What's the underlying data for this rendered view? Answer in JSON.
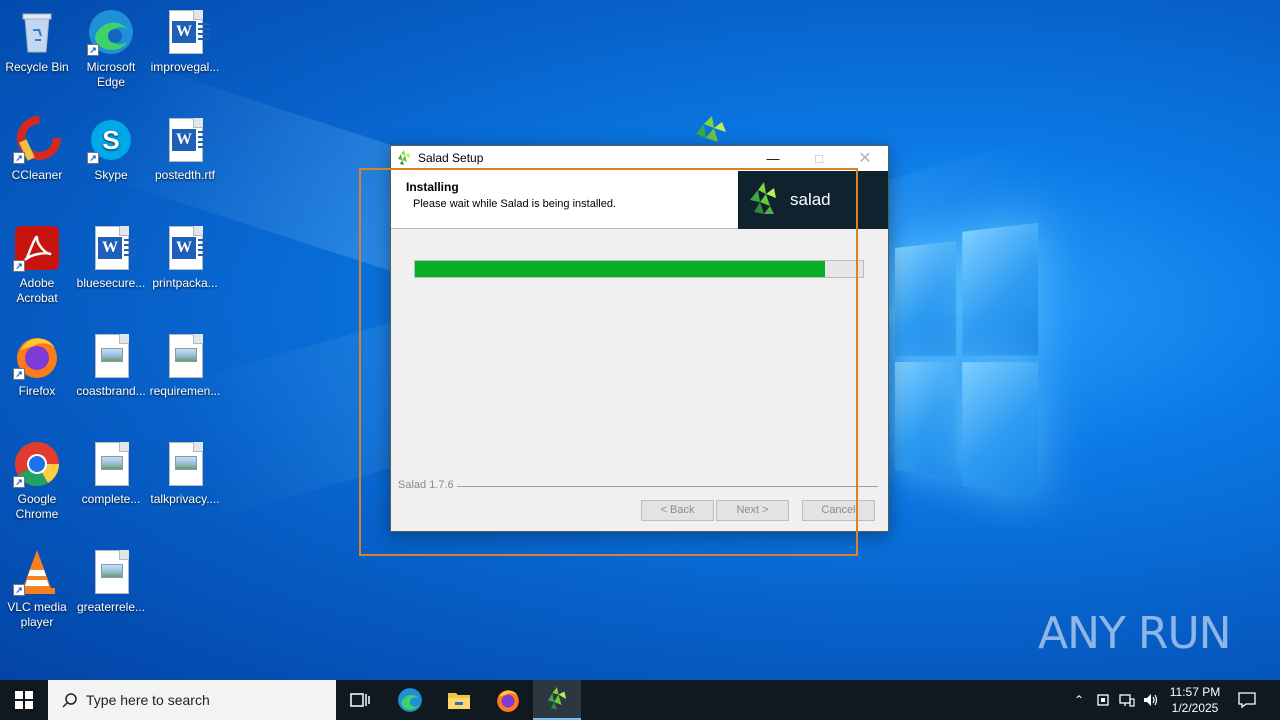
{
  "desktop": {
    "icons": [
      {
        "label": "Recycle Bin",
        "icon": "recycle-bin-icon"
      },
      {
        "label": "Microsoft Edge",
        "icon": "edge-icon"
      },
      {
        "label": "improvegal...",
        "icon": "word-document-icon"
      },
      {
        "label": "CCleaner",
        "icon": "ccleaner-icon"
      },
      {
        "label": "Skype",
        "icon": "skype-icon"
      },
      {
        "label": "postedth.rtf",
        "icon": "word-document-icon"
      },
      {
        "label": "Adobe Acrobat",
        "icon": "adobe-acrobat-icon"
      },
      {
        "label": "bluesecure...",
        "icon": "word-document-icon"
      },
      {
        "label": "printpacka...",
        "icon": "word-document-icon"
      },
      {
        "label": "Firefox",
        "icon": "firefox-icon"
      },
      {
        "label": "coastbrand...",
        "icon": "image-file-icon"
      },
      {
        "label": "requiremen...",
        "icon": "image-file-icon"
      },
      {
        "label": "Google Chrome",
        "icon": "chrome-icon"
      },
      {
        "label": "complete...",
        "icon": "image-file-icon"
      },
      {
        "label": "talkprivacy....",
        "icon": "image-file-icon"
      },
      {
        "label": "VLC media player",
        "icon": "vlc-icon"
      },
      {
        "label": "greaterrele...",
        "icon": "image-file-icon"
      }
    ]
  },
  "installer": {
    "title": "Salad Setup",
    "header_title": "Installing",
    "header_subtitle": "Please wait while Salad is being installed.",
    "brand_text": "salad",
    "progress_fraction": 0.915,
    "version": "Salad 1.7.6",
    "buttons": {
      "back": "< Back",
      "next": "Next >",
      "cancel": "Cancel"
    },
    "accent_color": "#06b025"
  },
  "taskbar": {
    "search_placeholder": "Type here to search",
    "clock_time": "11:57 PM",
    "clock_date": "1/2/2025"
  },
  "watermark": "ANY RUN"
}
